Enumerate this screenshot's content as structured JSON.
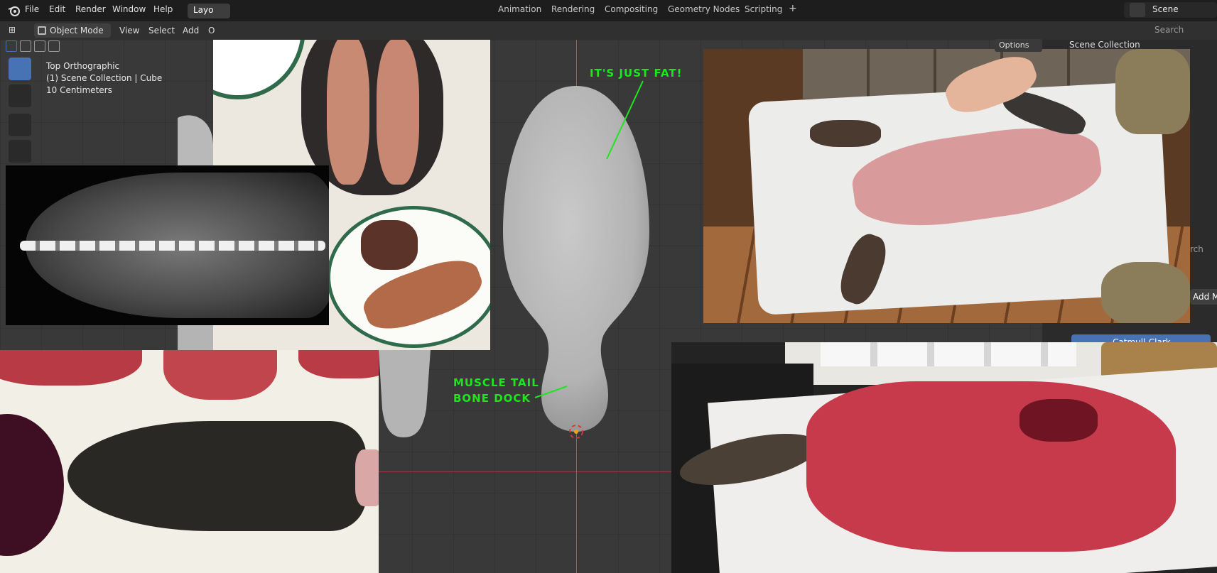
{
  "menu": {
    "items": [
      "File",
      "Edit",
      "Render",
      "Window",
      "Help"
    ]
  },
  "workspaces": {
    "active": "Layo",
    "tabs": [
      "Animation",
      "Rendering",
      "Compositing",
      "Geometry Nodes",
      "Scripting"
    ],
    "add": "+"
  },
  "scene": {
    "label": "Scene"
  },
  "viewport_header": {
    "mode": "Object Mode",
    "menus": [
      "View",
      "Select",
      "Add",
      "O"
    ],
    "options": "Options"
  },
  "viewport_info": {
    "view": "Top Orthographic",
    "collection": "(1) Scene Collection | Cube",
    "scale": "10 Centimeters"
  },
  "outliner": {
    "search_placeholder": "Search",
    "scene_collection": "Scene Collection"
  },
  "properties": {
    "search_partial": "rch",
    "add_modifier_partial": "Add M",
    "subdivision": "Catmull-Clark"
  },
  "annotations": {
    "fat": "IT'S JUST FAT!",
    "muscle_line1": "MUSCLE TAIL",
    "muscle_line2": "BONE DOCK"
  },
  "colors": {
    "accent": "#4772b3",
    "annotation": "#1ee61e",
    "x_axis": "#9a3a44",
    "y_axis": "#5c8a2c"
  }
}
